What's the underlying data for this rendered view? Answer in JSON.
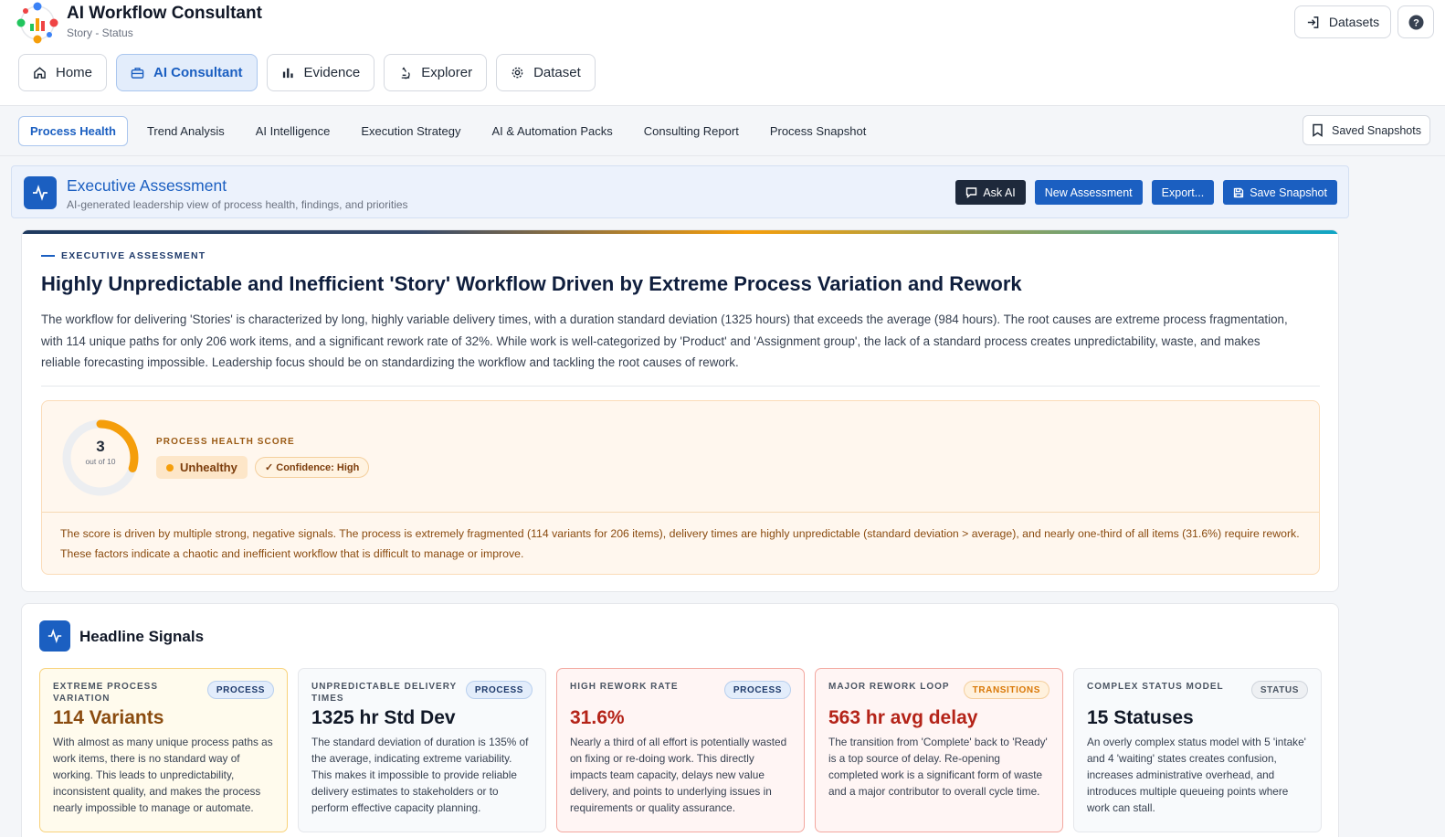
{
  "app": {
    "title": "AI Workflow Consultant",
    "subtitle": "Story - Status"
  },
  "nav": {
    "items": [
      {
        "label": "Home",
        "icon": "home-icon",
        "active": false
      },
      {
        "label": "AI Consultant",
        "icon": "briefcase-icon",
        "active": true
      },
      {
        "label": "Evidence",
        "icon": "bar-chart-icon",
        "active": false
      },
      {
        "label": "Explorer",
        "icon": "microscope-icon",
        "active": false
      },
      {
        "label": "Dataset",
        "icon": "gear-icon",
        "active": false
      }
    ],
    "datasets_label": "Datasets"
  },
  "subtabs": {
    "items": [
      "Process Health",
      "Trend Analysis",
      "AI Intelligence",
      "Execution Strategy",
      "AI & Automation Packs",
      "Consulting Report",
      "Process Snapshot"
    ],
    "active_index": 0,
    "saved_label": "Saved Snapshots"
  },
  "assessment": {
    "title": "Executive Assessment",
    "subtitle": "AI-generated leadership view of process health, findings, and priorities",
    "actions": {
      "ask_ai": "Ask AI",
      "new_assessment": "New Assessment",
      "export": "Export...",
      "save_snapshot": "Save Snapshot"
    }
  },
  "exec": {
    "eyebrow": "EXECUTIVE ASSESSMENT",
    "headline": "Highly Unpredictable and Inefficient 'Story' Workflow Driven by Extreme Process Variation and Rework",
    "summary": "The workflow for delivering 'Stories' is characterized by long, highly variable delivery times, with a duration standard deviation (1325 hours) that exceeds the average (984 hours). The root causes are extreme process fragmentation, with 114 unique paths for only 206 work items, and a significant rework rate of 32%. While work is well-categorized by 'Product' and 'Assignment group', the lack of a standard process creates unpredictability, waste, and makes reliable forecasting impossible. Leadership focus should be on standardizing the workflow and tackling the root causes of rework.",
    "score": {
      "value": 3,
      "max": 10,
      "value_text": "3",
      "out_of_text": "out of 10",
      "label": "PROCESS HEALTH SCORE",
      "status": "Unhealthy",
      "confidence": "✓ Confidence: High",
      "explanation": "The score is driven by multiple strong, negative signals. The process is extremely fragmented (114 variants for 206 items), delivery times are highly unpredictable (standard deviation > average), and nearly one-third of all items (31.6%) require rework. These factors indicate a chaotic and inefficient workflow that is difficult to manage or improve.",
      "colors": {
        "arc": "#f59e0b",
        "track": "#eceef1"
      }
    }
  },
  "signals": {
    "title": "Headline Signals",
    "cards": [
      {
        "label": "EXTREME PROCESS VARIATION",
        "tag": "PROCESS",
        "value": "114 Variants",
        "desc": "With almost as many unique process paths as work items, there is no standard way of working. This leads to unpredictability, inconsistent quality, and makes the process nearly impossible to manage or automate."
      },
      {
        "label": "UNPREDICTABLE DELIVERY TIMES",
        "tag": "PROCESS",
        "value": "1325 hr Std Dev",
        "desc": "The standard deviation of duration is 135% of the average, indicating extreme variability. This makes it impossible to provide reliable delivery estimates to stakeholders or to perform effective capacity planning."
      },
      {
        "label": "HIGH REWORK RATE",
        "tag": "PROCESS",
        "value": "31.6%",
        "desc": "Nearly a third of all effort is potentially wasted on fixing or re-doing work. This directly impacts team capacity, delays new value delivery, and points to underlying issues in requirements or quality assurance."
      },
      {
        "label": "MAJOR REWORK LOOP",
        "tag": "TRANSITIONS",
        "value": "563 hr avg delay",
        "desc": "The transition from 'Complete' back to 'Ready' is a top source of delay. Re-opening completed work is a significant form of waste and a major contributor to overall cycle time."
      },
      {
        "label": "COMPLEX STATUS MODEL",
        "tag": "STATUS",
        "value": "15 Statuses",
        "desc": "An overly complex status model with 5 'intake' and 4 'waiting' states creates confusion, increases administrative overhead, and introduces multiple queueing points where work can stall."
      }
    ]
  }
}
